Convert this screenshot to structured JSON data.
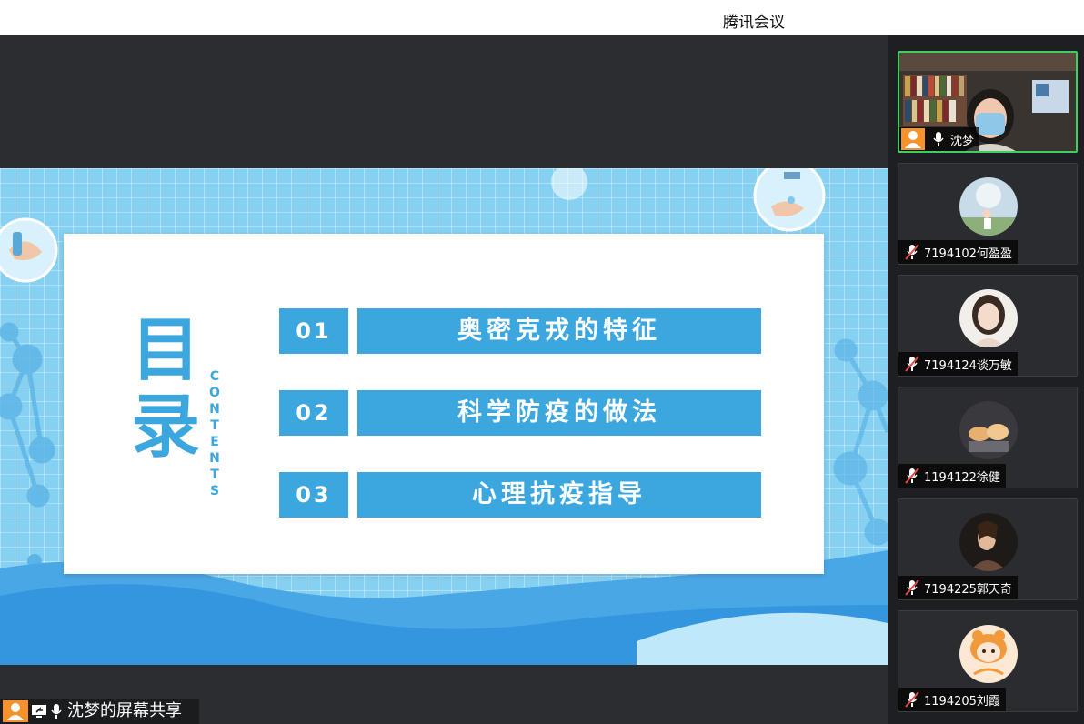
{
  "window": {
    "title": "腾讯会议"
  },
  "slide": {
    "heading": "目录",
    "heading_chars": [
      "目",
      "录"
    ],
    "subheading": "CONTENTS",
    "subheading_chars": [
      "C",
      "O",
      "N",
      "T",
      "E",
      "N",
      "T",
      "S"
    ],
    "items": [
      {
        "num": "01",
        "label": "奥密克戎的特征"
      },
      {
        "num": "02",
        "label": "科学防疫的做法"
      },
      {
        "num": "03",
        "label": "心理抗疫指导"
      }
    ],
    "accent_color": "#3ba7de"
  },
  "share": {
    "label": "沈梦的屏幕共享"
  },
  "participants": [
    {
      "name": "沈梦",
      "video": true,
      "mic": "on",
      "icon": "user-icon"
    },
    {
      "name": "7194102何盈盈",
      "mic": "off",
      "icon": "mic-off-icon"
    },
    {
      "name": "7194124谈万敏",
      "mic": "off",
      "icon": "mic-off-icon"
    },
    {
      "name": "1194122徐健",
      "mic": "off",
      "icon": "mic-off-icon"
    },
    {
      "name": "7194225郭天奇",
      "mic": "off",
      "icon": "mic-off-icon"
    },
    {
      "name": "1194205刘霞",
      "mic": "off",
      "icon": "mic-off-icon"
    }
  ],
  "colors": {
    "active_speaker_border": "#3ecf5d",
    "user_badge": "#f6922e",
    "mic_off": "#e84a4a"
  }
}
